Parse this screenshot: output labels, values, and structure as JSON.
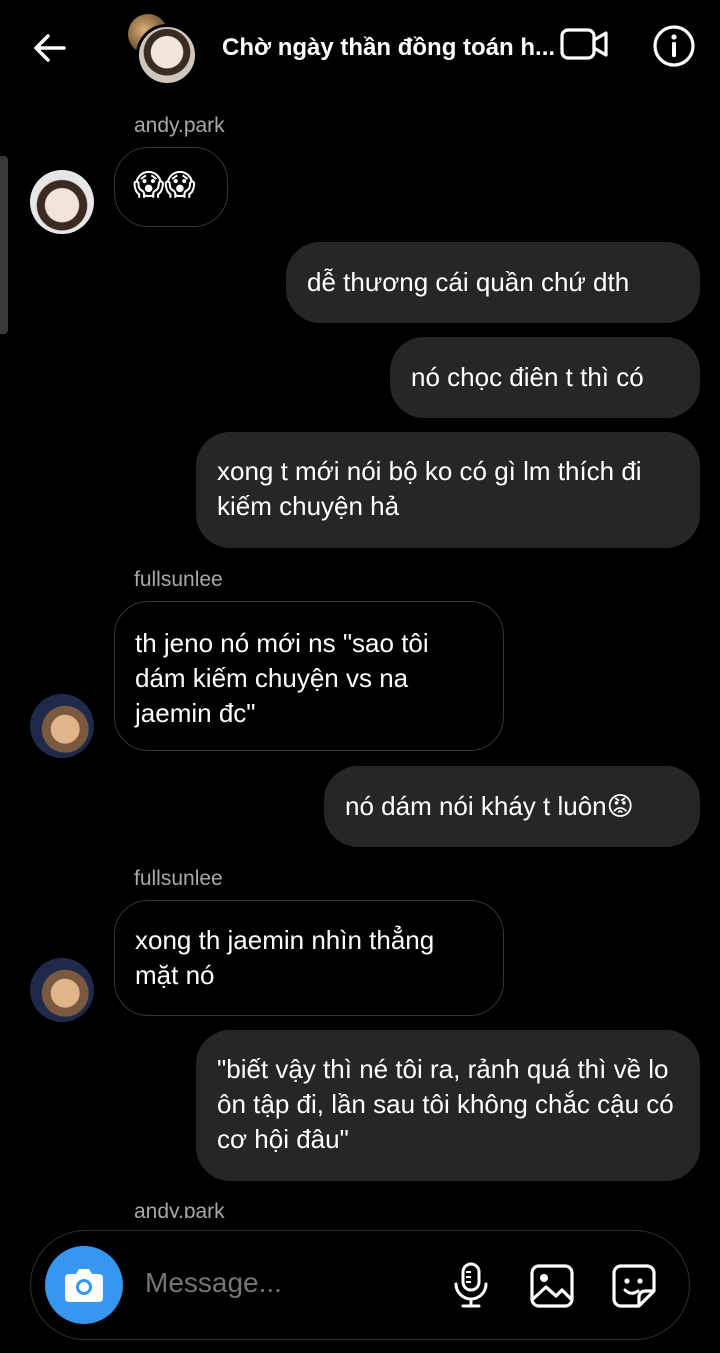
{
  "header": {
    "title": "Chờ ngày thần đồng toán h...",
    "back_icon": "arrow-left-icon",
    "video_icon": "video-call-icon",
    "info_icon": "info-icon"
  },
  "messages": [
    {
      "sender": "andy.park",
      "text": "😱😱",
      "dir": "in"
    },
    {
      "text": "dễ thương cái quần chứ dth",
      "dir": "out"
    },
    {
      "text": "nó chọc điên t thì có",
      "dir": "out"
    },
    {
      "text": "xong t mới nói bộ ko có gì lm thích đi kiếm chuyện hả",
      "dir": "out"
    },
    {
      "sender": "fullsunlee",
      "text": "th jeno nó mới ns \"sao tôi dám kiếm chuyện vs na jaemin đc\"",
      "dir": "in"
    },
    {
      "text": "nó dám nói kháy t luôn😡",
      "dir": "out"
    },
    {
      "sender": "fullsunlee",
      "text": "xong th jaemin nhìn thẳng mặt nó",
      "dir": "in"
    },
    {
      "text": "\"biết vậy thì né tôi ra, rảnh quá thì về lo ôn tập đi, lần sau tôi không chắc cậu có cơ hội đâu\"",
      "dir": "out"
    }
  ],
  "partial_sender": "andy.park",
  "composer": {
    "placeholder": "Message...",
    "camera_icon": "camera-icon",
    "mic_icon": "microphone-icon",
    "gallery_icon": "gallery-icon",
    "sticker_icon": "sticker-icon",
    "accent": "#3797f0"
  }
}
